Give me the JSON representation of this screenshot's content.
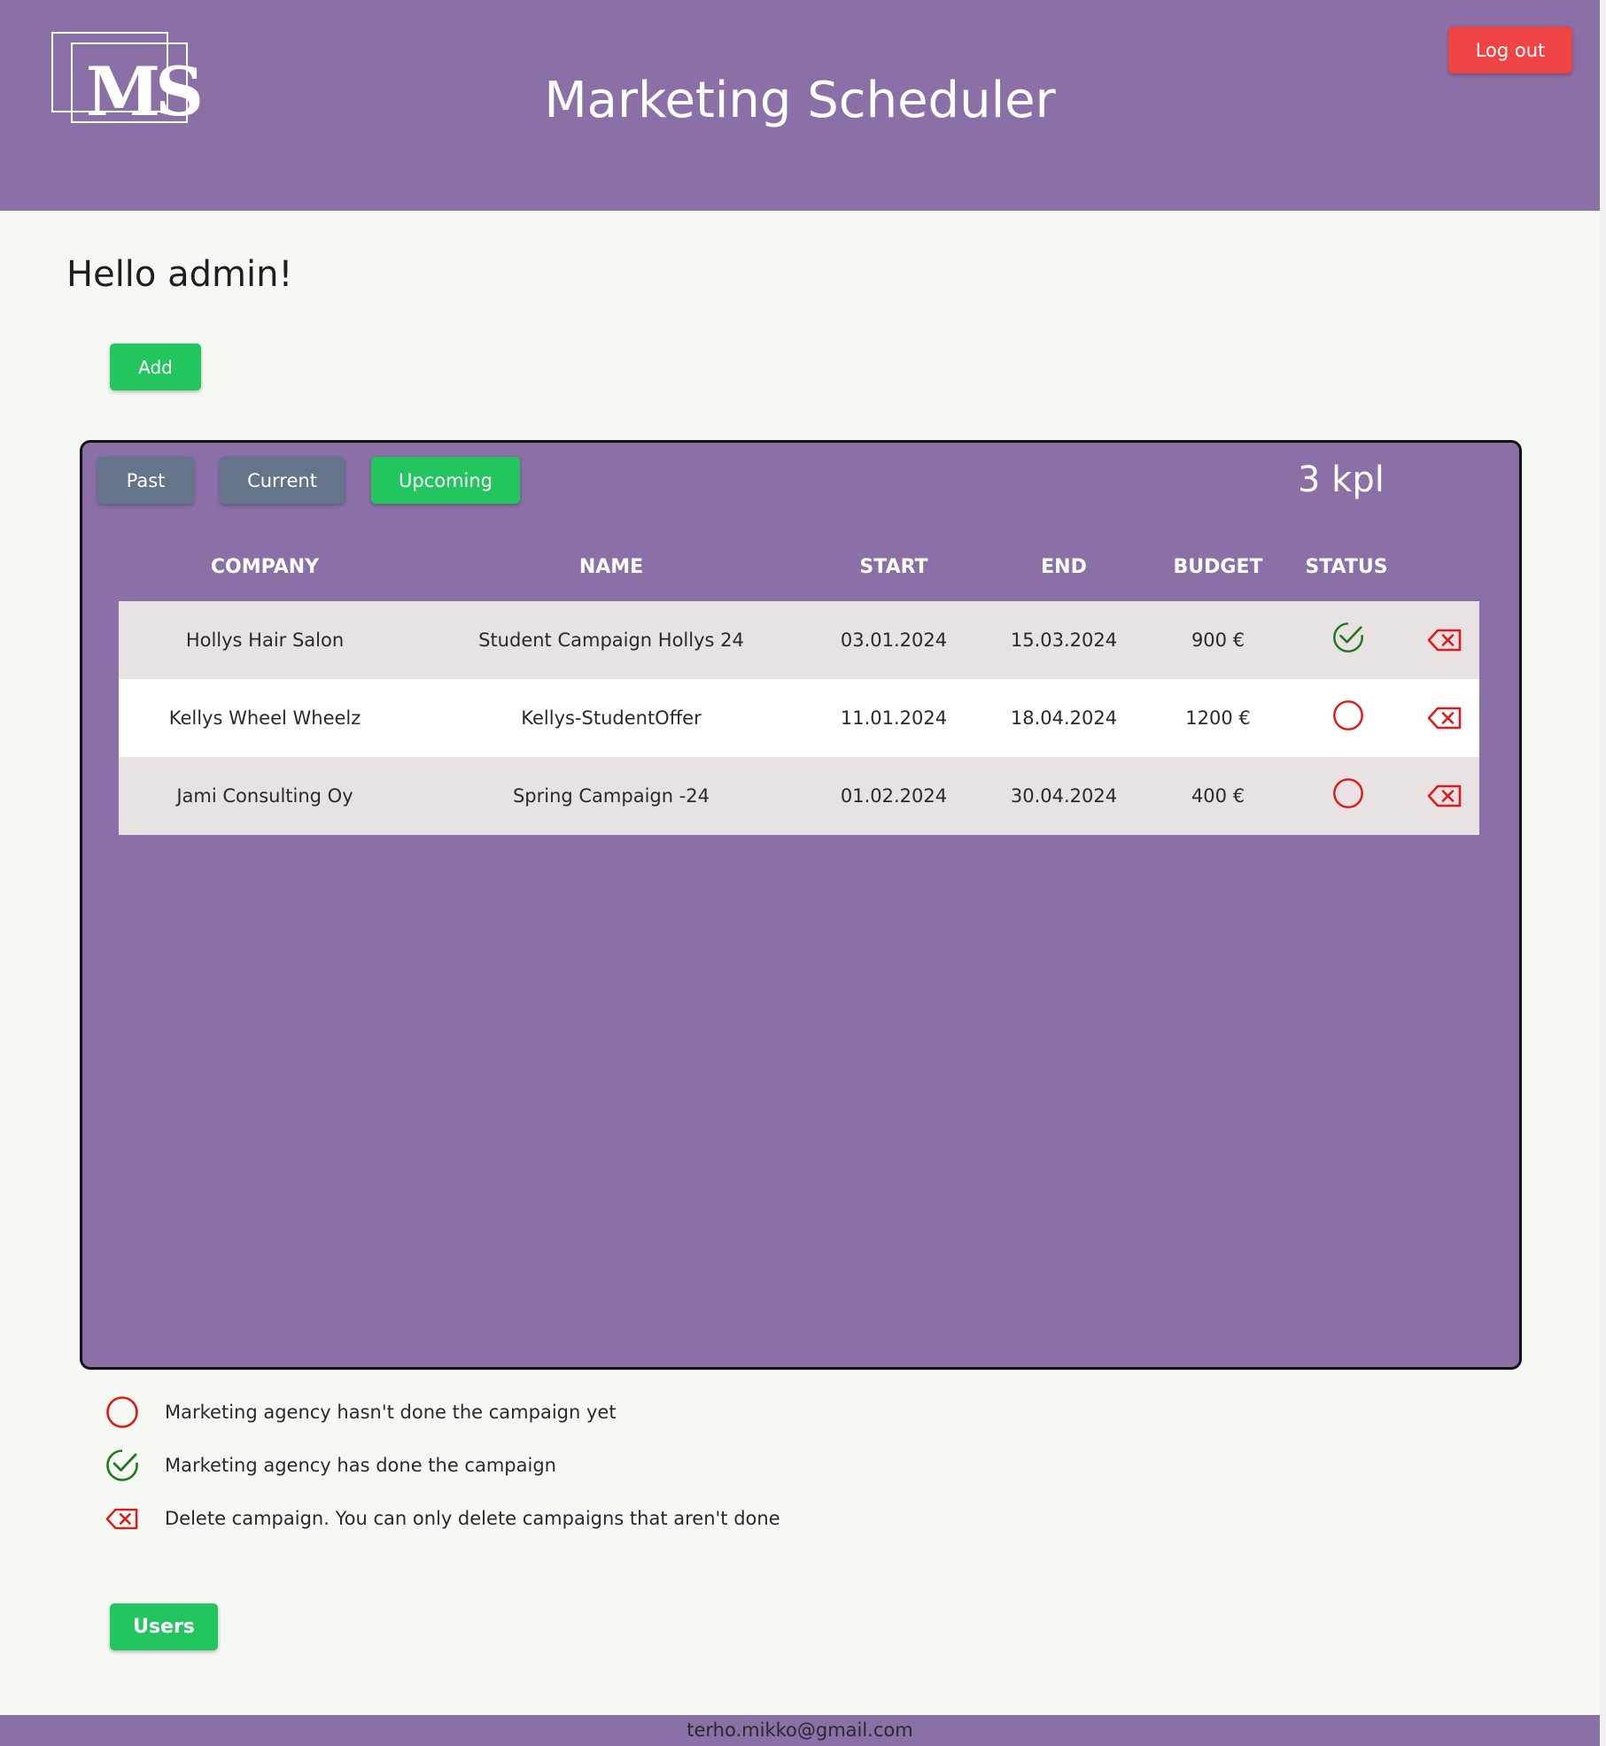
{
  "header": {
    "logo_text": "MS",
    "title": "Marketing Scheduler",
    "logout_label": "Log out"
  },
  "greeting": "Hello admin!",
  "add_label": "Add",
  "panel": {
    "tabs": [
      {
        "label": "Past",
        "active": false
      },
      {
        "label": "Current",
        "active": false
      },
      {
        "label": "Upcoming",
        "active": true
      }
    ],
    "count": "3 kpl",
    "columns": [
      "COMPANY",
      "NAME",
      "START",
      "END",
      "BUDGET",
      "STATUS"
    ],
    "rows": [
      {
        "company": "Hollys Hair Salon",
        "name": "Student Campaign Hollys 24",
        "start": "03.01.2024",
        "end": "15.03.2024",
        "budget": "900 €",
        "status": "done-icon"
      },
      {
        "company": "Kellys Wheel Wheelz",
        "name": "Kellys-StudentOffer",
        "start": "11.01.2024",
        "end": "18.04.2024",
        "budget": "1200 €",
        "status": "not-done-icon"
      },
      {
        "company": "Jami Consulting Oy",
        "name": "Spring Campaign -24",
        "start": "01.02.2024",
        "end": "30.04.2024",
        "budget": "400 €",
        "status": "not-done-icon"
      }
    ]
  },
  "legend": [
    {
      "icon": "not-done-icon",
      "text": "Marketing agency hasn't done the campaign yet"
    },
    {
      "icon": "done-icon",
      "text": "Marketing agency has done the campaign"
    },
    {
      "icon": "delete-icon",
      "text": "Delete campaign. You can only delete campaigns that aren't done"
    }
  ],
  "users_label": "Users",
  "footer_email": "terho.mikko@gmail.com",
  "colors": {
    "brand_purple": "#8a70a7",
    "success_green": "#22c55e",
    "danger_red": "#ef4444",
    "tab_gray": "#64748b",
    "check_green": "#1f7a1f",
    "cross_red": "#e01919"
  }
}
